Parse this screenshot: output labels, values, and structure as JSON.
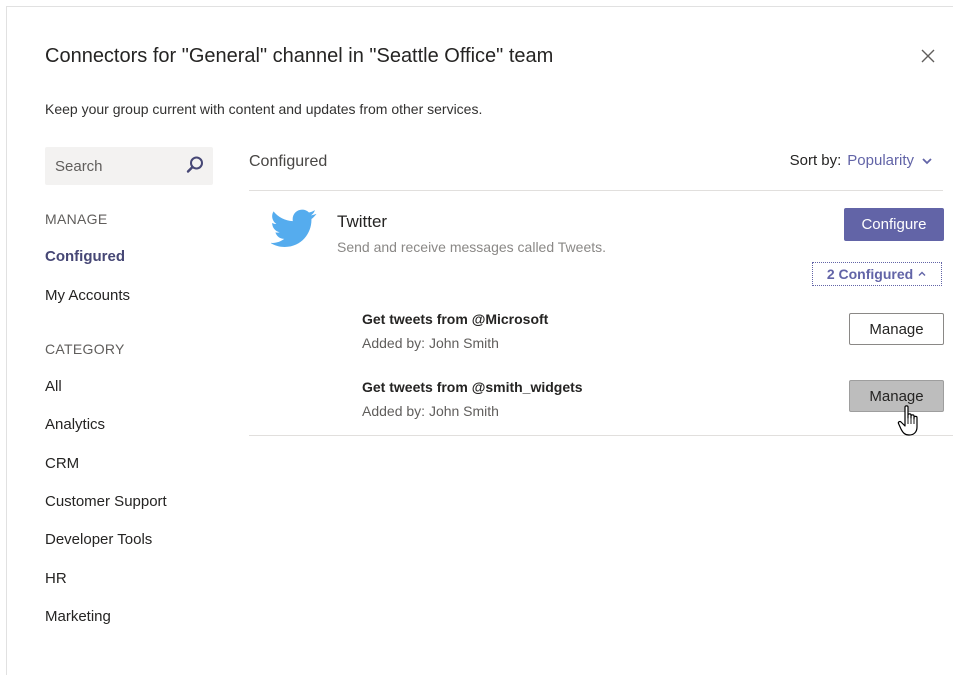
{
  "dialog": {
    "title": "Connectors for \"General\" channel in \"Seattle Office\" team",
    "subtitle": "Keep your group current with content and updates from other services.",
    "close_icon": "close-icon"
  },
  "search": {
    "placeholder": "Search",
    "icon": "search-icon"
  },
  "sidebar": {
    "manage_heading": "MANAGE",
    "manage_items": [
      {
        "label": "Configured",
        "active": true
      },
      {
        "label": "My Accounts",
        "active": false
      }
    ],
    "category_heading": "CATEGORY",
    "category_items": [
      {
        "label": "All"
      },
      {
        "label": "Analytics"
      },
      {
        "label": "CRM"
      },
      {
        "label": "Customer Support"
      },
      {
        "label": "Developer Tools"
      },
      {
        "label": "HR"
      },
      {
        "label": "Marketing"
      }
    ]
  },
  "main": {
    "section_title": "Configured",
    "sort": {
      "label": "Sort by:",
      "value": "Popularity"
    },
    "connector": {
      "name": "Twitter",
      "description": "Send and receive messages called Tweets.",
      "icon": "twitter-logo",
      "configure_label": "Configure",
      "configured_count_label": "2 Configured",
      "configurations": [
        {
          "title": "Get tweets from @Microsoft",
          "added_by": "Added by: John Smith",
          "button": "Manage",
          "hovered": false
        },
        {
          "title": "Get tweets from @smith_widgets",
          "added_by": "Added by: John Smith",
          "button": "Manage",
          "hovered": true
        }
      ]
    }
  },
  "colors": {
    "accent": "#6264a7",
    "active_nav": "#464775",
    "twitter": "#55acee",
    "hover_button": "#bdbdbd"
  }
}
